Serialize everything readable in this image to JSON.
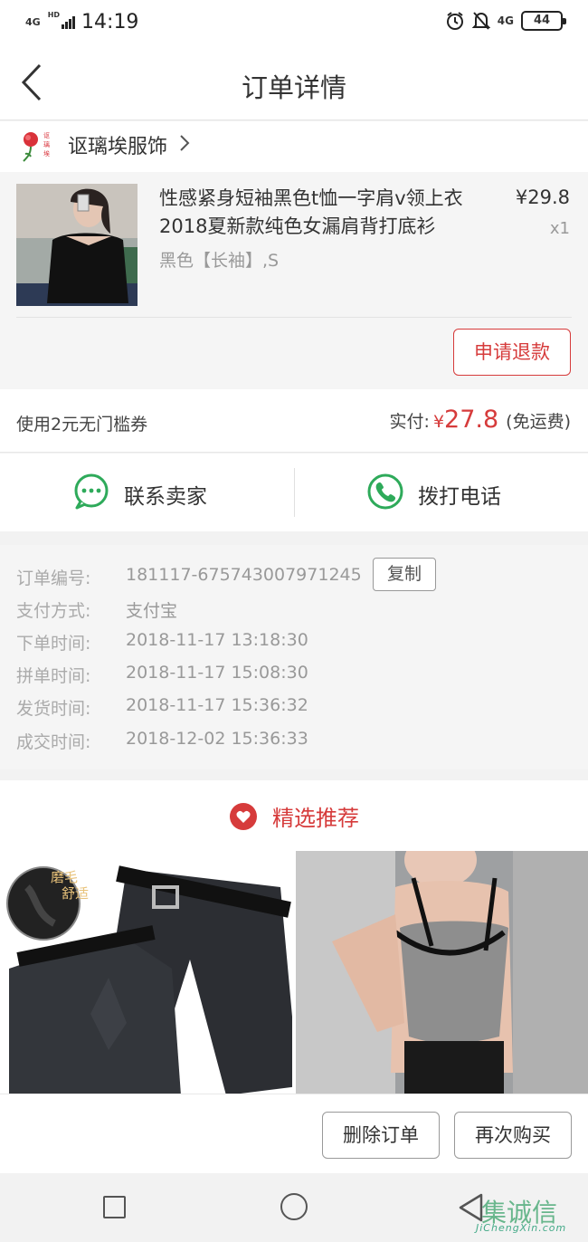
{
  "status_bar": {
    "network": "4G",
    "network_sup": "HD",
    "time": "14:19",
    "network_right": "4G",
    "battery": "44"
  },
  "header": {
    "title": "订单详情"
  },
  "shop": {
    "name": "讴璃埃服饰"
  },
  "product": {
    "name": "性感紧身短袖黑色t恤一字肩v领上衣2018夏新款纯色女漏肩背打底衫",
    "spec": "黑色【长袖】,S",
    "price": "¥29.8",
    "quantity": "x1",
    "refund_label": "申请退款"
  },
  "payment": {
    "coupon": "使用2元无门槛券",
    "paid_label": "实付:",
    "currency": "¥",
    "amount": "27.8",
    "shipping": "(免运费)"
  },
  "actions": {
    "contact_seller": "联系卖家",
    "call": "拨打电话"
  },
  "order_info": {
    "rows": [
      {
        "label": "订单编号:",
        "value": "181117-675743007971245"
      },
      {
        "label": "支付方式:",
        "value": "支付宝"
      },
      {
        "label": "下单时间:",
        "value": "2018-11-17 13:18:30"
      },
      {
        "label": "拼单时间:",
        "value": "2018-11-17 15:08:30"
      },
      {
        "label": "发货时间:",
        "value": "2018-11-17 15:36:32"
      },
      {
        "label": "成交时间:",
        "value": "2018-12-02 15:36:33"
      }
    ],
    "copy_label": "复制"
  },
  "recommend": {
    "title": "精选推荐",
    "badge_line1": "磨毛",
    "badge_line2": "舒适"
  },
  "bottom_bar": {
    "delete_label": "删除订单",
    "rebuy_label": "再次购买"
  },
  "watermark": {
    "text": "JiChengXin.com",
    "glyphs": "集诚信"
  },
  "colors": {
    "accent": "#d63b3b",
    "green": "#2eaa5a"
  }
}
